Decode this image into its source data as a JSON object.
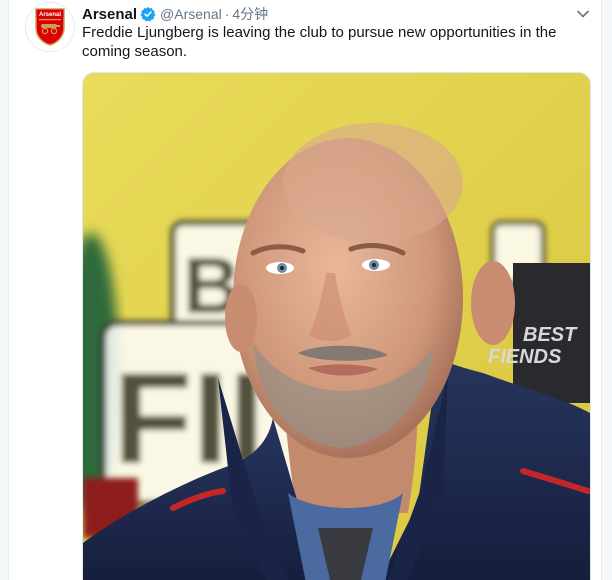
{
  "tweet": {
    "display_name": "Arsenal",
    "verified": true,
    "handle": "@Arsenal",
    "separator": "·",
    "timestamp": "4分钟",
    "text": "Freddie Ljungberg is leaving the club to pursue new opportunities in the coming season.",
    "avatar_icon": "arsenal-crest-icon",
    "avatar_label": "Arsenal",
    "menu_icon": "chevron-down-icon"
  },
  "media": {
    "background_sign_line1": "BE",
    "background_sign_line2": "FII",
    "background_badge_line1": "BEST",
    "background_badge_line2": "FIENDS"
  },
  "colors": {
    "arsenal_red": "#db0007",
    "verified_blue": "#1da1f2",
    "text_primary": "#14171a",
    "text_secondary": "#657786",
    "photo_background_yellow": "#e6d54a",
    "jacket_navy": "#1d2a4f"
  }
}
